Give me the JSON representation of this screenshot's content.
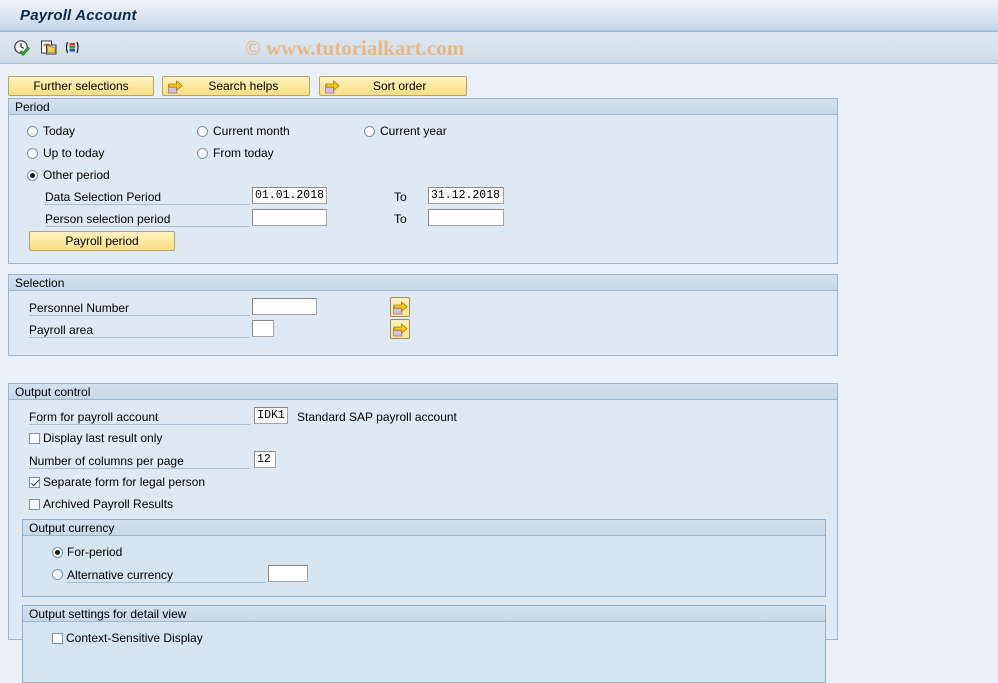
{
  "window": {
    "title": "Payroll Account"
  },
  "toolbar": {
    "icons": [
      {
        "name": "execute-clock-icon",
        "title": "Execute"
      },
      {
        "name": "copy-variant-icon",
        "title": "Get Variant"
      },
      {
        "name": "color-bars-icon",
        "title": "Display"
      }
    ]
  },
  "watermark": {
    "text": "© www.tutorialkart.com"
  },
  "action_buttons": [
    {
      "label": "Further selections",
      "icon": null
    },
    {
      "label": "Search helps",
      "icon": "arrow-right-icon"
    },
    {
      "label": "Sort order",
      "icon": "arrow-right-icon"
    }
  ],
  "period": {
    "header": "Period",
    "radios": [
      {
        "label": "Today",
        "selected": false
      },
      {
        "label": "Current month",
        "selected": false
      },
      {
        "label": "Current year",
        "selected": false
      },
      {
        "label": "Up to today",
        "selected": false
      },
      {
        "label": "From today",
        "selected": false
      },
      {
        "label": "Other period",
        "selected": true
      }
    ],
    "data_selection_period_label": "Data Selection Period",
    "data_selection_period_from": "01.01.2018",
    "data_selection_to_label": "To",
    "data_selection_period_to": "31.12.2018",
    "person_selection_period_label": "Person selection period",
    "person_selection_period_from": "",
    "person_selection_to_label": "To",
    "person_selection_period_to": "",
    "payroll_period_button": "Payroll period"
  },
  "selection": {
    "header": "Selection",
    "personnel_number_label": "Personnel Number",
    "personnel_number_value": "",
    "payroll_area_label": "Payroll area",
    "payroll_area_value": "",
    "multi_select_icon": "arrow-right-icon"
  },
  "output_control": {
    "header": "Output control",
    "form_label": "Form for payroll account",
    "form_value": "IDK1",
    "form_description": "Standard SAP payroll account",
    "display_last_result_only": {
      "label": "Display last result only",
      "checked": false
    },
    "columns_per_page_label": "Number of columns per page",
    "columns_per_page_value": "12",
    "separate_form_legal_person": {
      "label": "Separate form for legal person",
      "checked": true
    },
    "archived_payroll_results": {
      "label": "Archived Payroll Results",
      "checked": false
    },
    "output_currency": {
      "header": "Output currency",
      "for_period": {
        "label": "For-period",
        "selected": true
      },
      "alternative": {
        "label": "Alternative currency",
        "selected": false,
        "value": ""
      }
    },
    "detail_view": {
      "header": "Output settings for detail view",
      "context_sensitive_display": {
        "label": "Context-Sensitive Display",
        "checked": false
      }
    }
  },
  "colors": {
    "window_bg": "#eaf0f7",
    "group_bg": "#dfe9f3",
    "group_header": "#c7d8e8",
    "button_yellow": "#f9e394",
    "border": "#9db6cd",
    "watermark": "#e8b784"
  }
}
